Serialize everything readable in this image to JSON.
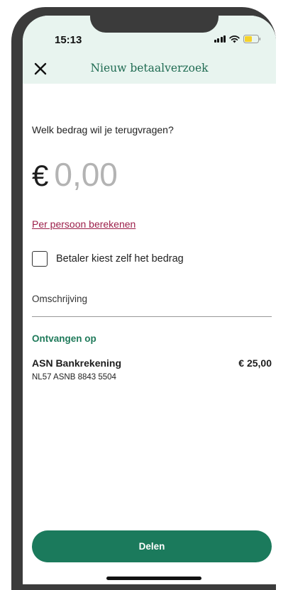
{
  "status_bar": {
    "time": "15:13",
    "signal_icon": "signal-bars-icon",
    "wifi_icon": "wifi-icon",
    "battery_icon": "battery-low-icon",
    "battery_color": "#f5d22b"
  },
  "header": {
    "close_icon": "close-icon",
    "title": "Nieuw betaalverzoek",
    "background": "#e8f4ef",
    "title_color": "#1f6b52"
  },
  "amount": {
    "question": "Welk bedrag wil je terugvragen?",
    "currency_symbol": "€",
    "placeholder": "0,00"
  },
  "per_person_link": "Per persoon berekenen",
  "payer_choice": {
    "label": "Betaler kiest zelf het bedrag",
    "checked": false
  },
  "description": {
    "placeholder": "Omschrijving"
  },
  "receive": {
    "heading": "Ontvangen op",
    "account_name": "ASN Bankrekening",
    "balance": "€ 25,00",
    "iban": "NL57 ASNB 8843 5504"
  },
  "share_button": {
    "label": "Delen",
    "color": "#1b7a5c"
  },
  "colors": {
    "link": "#9c1f4a",
    "accent_green": "#1f7a5a"
  }
}
